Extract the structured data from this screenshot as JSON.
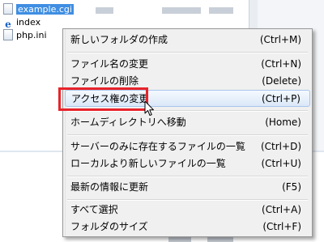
{
  "file_list": {
    "files": [
      {
        "name": "example.cgi",
        "icon": "file-icon",
        "selected": true
      },
      {
        "name": "index",
        "icon": "ie-html-icon",
        "selected": false
      },
      {
        "name": "php.ini",
        "icon": "file-icon",
        "selected": false
      }
    ]
  },
  "context_menu": {
    "items": [
      {
        "label": "新しいフォルダの作成",
        "shortcut": "(Ctrl+M)"
      },
      {
        "label": "ファイル名の変更",
        "shortcut": "(Ctrl+N)"
      },
      {
        "label": "ファイルの削除",
        "shortcut": "(Delete)"
      },
      {
        "label": "アクセス権の変更",
        "shortcut": "(Ctrl+P)",
        "hover": true
      },
      {
        "label": "ホームディレクトリへ移動",
        "shortcut": "(Home)"
      },
      {
        "label": "サーバーのみに存在するファイルの一覧",
        "shortcut": "(Ctrl+D)"
      },
      {
        "label": "ローカルより新しいファイルの一覧",
        "shortcut": "(Ctrl+U)"
      },
      {
        "label": "最新の情報に更新",
        "shortcut": "(F5)"
      },
      {
        "label": "すべて選択",
        "shortcut": "(Ctrl+A)"
      },
      {
        "label": "フォルダのサイズ",
        "shortcut": "(Ctrl+F)"
      }
    ]
  },
  "colors": {
    "highlight": "#e8232a",
    "selection": "#3f8ee2",
    "menu_background": "#f0f0f0",
    "menu_hover": "#dbe8f8"
  }
}
